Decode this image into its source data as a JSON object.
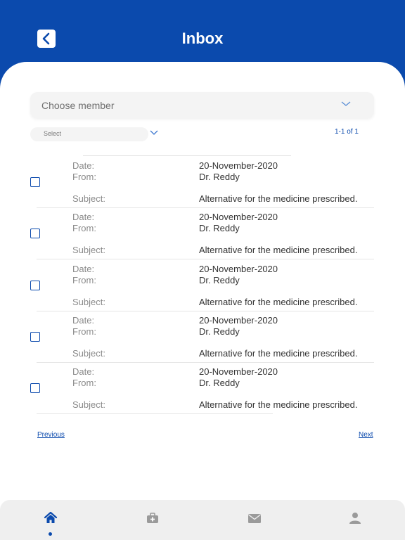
{
  "header": {
    "title": "Inbox"
  },
  "filters": {
    "member_placeholder": "Choose member",
    "select_placeholder": "Select",
    "page_count": "1-1 of 1"
  },
  "labels": {
    "date": "Date:",
    "from": "From:",
    "subject": "Subject:"
  },
  "messages": [
    {
      "date": "20-November-2020",
      "from": "Dr. Reddy",
      "subject": "Alternative for the medicine prescribed.",
      "checked": false
    },
    {
      "date": "20-November-2020",
      "from": "Dr. Reddy",
      "subject": "Alternative for the medicine prescribed.",
      "checked": false
    },
    {
      "date": "20-November-2020",
      "from": "Dr. Reddy",
      "subject": "Alternative for the medicine prescribed.",
      "checked": false
    },
    {
      "date": "20-November-2020",
      "from": "Dr. Reddy",
      "subject": "Alternative for the medicine prescribed.",
      "checked": false
    },
    {
      "date": "20-November-2020",
      "from": "Dr. Reddy",
      "subject": "Alternative for the medicine prescribed.",
      "checked": false
    }
  ],
  "pagination": {
    "previous": "Previous",
    "next": "Next"
  },
  "tabbar": {
    "items": [
      {
        "icon": "home-icon",
        "active": true
      },
      {
        "icon": "medical-kit-icon",
        "active": false
      },
      {
        "icon": "mail-icon",
        "active": false
      },
      {
        "icon": "profile-icon",
        "active": false
      }
    ]
  },
  "colors": {
    "primary": "#0b4aad",
    "inactive_icon": "#9a9a9a"
  }
}
